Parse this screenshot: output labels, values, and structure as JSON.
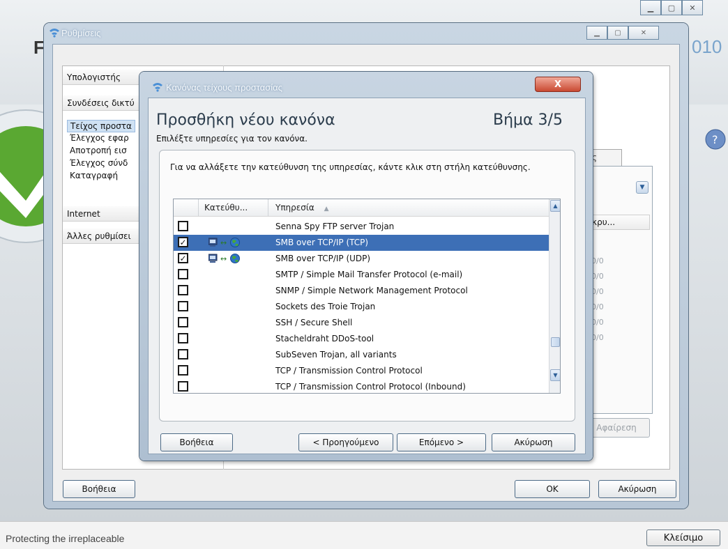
{
  "app": {
    "brand_letter": "F",
    "year_fragment": "010",
    "tagline": "Protecting the irreplaceable",
    "close_button": "Κλείσιμο"
  },
  "settings": {
    "title": "Ρυθμίσεις",
    "categories": [
      "Υπολογιστής",
      "Συνδέσεις δικτύ",
      "Internet",
      "Άλλες ρυθμίσει"
    ],
    "subitems": [
      "Τείχος προστα",
      "Έλεγχος εφαρ",
      "Αποτροπή εισ",
      "Έλεγχος σύνδ",
      "Καταγραφή"
    ],
    "bg_tab_fragment": "ς",
    "bg_column_fragment": "κρυ...",
    "bg_values": [
      "0/0",
      "0/0",
      "0/0",
      "0/0",
      "0/0",
      "0/0"
    ],
    "bg_remove": "Αφαίρεση",
    "help_button": "Βοήθεια",
    "ok_button": "OK",
    "cancel_button": "Ακύρωση"
  },
  "wizard": {
    "title": "Κανόνας τείχους προστασίας",
    "close_glyph": "X",
    "heading": "Προσθήκη νέου κανόνα",
    "step": "Βήμα 3/5",
    "subtitle": "Επιλέξτε υπηρεσίες για τον κανόνα.",
    "instruction": "Για να αλλάξετε την κατεύθυνση της υπηρεσίας, κάντε κλικ στη στήλη κατεύθυνσης.",
    "col_direction": "Κατεύθυ...",
    "col_service": "Υπηρεσία",
    "sort_glyph": "▲",
    "check_glyph": "✓",
    "services": [
      {
        "name": "Senna Spy FTP server Trojan",
        "checked": false,
        "selected": false
      },
      {
        "name": "SMB over TCP/IP (TCP)",
        "checked": true,
        "selected": true
      },
      {
        "name": "SMB over TCP/IP (UDP)",
        "checked": true,
        "selected": false
      },
      {
        "name": "SMTP / Simple Mail Transfer Protocol (e-mail)",
        "checked": false,
        "selected": false
      },
      {
        "name": "SNMP / Simple Network Management Protocol",
        "checked": false,
        "selected": false
      },
      {
        "name": "Sockets des Troie Trojan",
        "checked": false,
        "selected": false
      },
      {
        "name": "SSH / Secure Shell",
        "checked": false,
        "selected": false
      },
      {
        "name": "Stacheldraht DDoS-tool",
        "checked": false,
        "selected": false
      },
      {
        "name": "SubSeven Trojan, all variants",
        "checked": false,
        "selected": false
      },
      {
        "name": "TCP / Transmission Control Protocol",
        "checked": false,
        "selected": false
      },
      {
        "name": "TCP / Transmission Control Protocol (Inbound)",
        "checked": false,
        "selected": false
      }
    ],
    "help_button": "Βοήθεια",
    "back_button": "< Προηγούμενο",
    "next_button": "Επόμενο >",
    "cancel_button": "Ακύρωση"
  },
  "colors": {
    "selection": "#3d6fb6",
    "accent": "#7aa4cc",
    "close_red": "#c94a32",
    "brand_green": "#5aa832"
  }
}
